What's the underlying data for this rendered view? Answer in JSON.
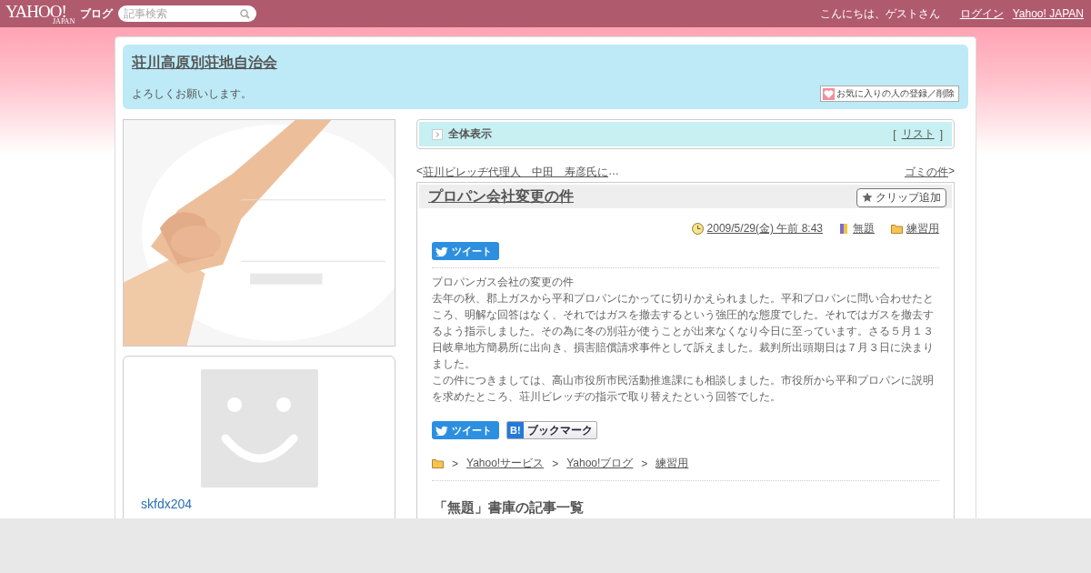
{
  "topbar": {
    "logo": "YAHOO!",
    "logo_sub": "JAPAN",
    "service": "ブログ",
    "search": {
      "placeholder": "記事検索"
    },
    "greeting": "こんにちは、ゲストさん",
    "links": [
      "ログイン",
      "Yahoo! JAPAN"
    ]
  },
  "blog": {
    "title": "荘川高原別荘地自治会",
    "description": "よろしくお願いします。",
    "favorite_button": "お気に入りの人の登録／削除"
  },
  "sidebar": {
    "profile": {
      "username": "skfdx204"
    }
  },
  "view_bar": {
    "label": "全体表示",
    "bracket_open": "[",
    "list_link": "リスト",
    "bracket_close": "]"
  },
  "nav": {
    "prev_mark": "<",
    "prev": "荘川ビレッヂ代理人　中田　寿彦氏に",
    "prev_ellipsis": "…",
    "next": "ゴミの件",
    "next_mark": ">"
  },
  "article": {
    "title": "プロパン会社変更の件",
    "clip_button": "クリップ追加",
    "date": "2009/5/29(金) 午前 8:43",
    "category": "無題",
    "folder": "練習用",
    "tweet": "ツイート",
    "paragraphs": [
      "プロパンガス会社の変更の件",
      "去年の秋、郡上ガスから平和プロパンにかってに切りかえられました。平和プロパンに問い合わせたところ、明解な回答はなく、それではガスを撤去するという強圧的な態度でした。それではガスを撤去するよう指示しました。その為に冬の別荘が使うことが出来なくなり今日に至っています。さる５月１３日岐阜地方簡易所に出向き、損害賠償請求事件として訴えました。裁判所出頭期日は７月３日に決まりました。",
      "この件につきましては、高山市役所市民活動推進課にも相談しました。市役所から平和プロパンに説明を求めたところ、荘川ビレッヂの指示で取り替えたという回答でした。"
    ],
    "share": [
      {
        "kind": "tweet",
        "label": "ツイート"
      },
      {
        "kind": "bookmark",
        "badge": "B!",
        "label": "ブックマーク"
      }
    ],
    "breadcrumb": [
      {
        "sep": ">",
        "label": "Yahoo!サービス"
      },
      {
        "sep": ">",
        "label": "Yahoo!ブログ"
      },
      {
        "sep": ">",
        "label": "練習用"
      }
    ],
    "list_heading": "「無題」書庫の記事一覧"
  }
}
